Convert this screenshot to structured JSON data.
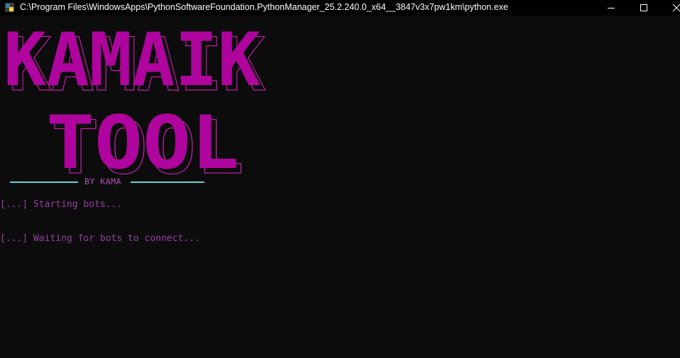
{
  "window": {
    "title": "C:\\Program Files\\WindowsApps\\PythonSoftwareFoundation.PythonManager_25.2.240.0_x64__3847v3x7pw1km\\python.exe",
    "icons": {
      "app": "python-icon",
      "minimize": "minimize-icon",
      "maximize": "maximize-icon",
      "close": "close-icon"
    }
  },
  "banner": {
    "line1": "KAMAIK",
    "line2": "TOOL",
    "byline": "BY KAMA",
    "colors": {
      "fill": "#b0049e",
      "shadow": "#c020a8",
      "rule": "#5fd7d0",
      "byline": "#b24fb8"
    }
  },
  "console": {
    "lines": [
      "[...] Starting bots...",
      "[...] Waiting for bots to connect..."
    ],
    "text_color": "#9a3fa8",
    "background": "#0c0c0c"
  }
}
